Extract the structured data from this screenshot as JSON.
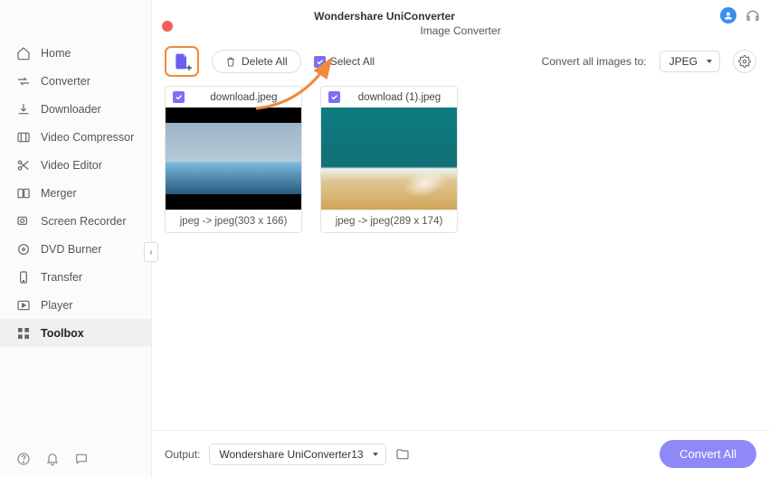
{
  "app_title": "Wondershare UniConverter",
  "panel_title": "Image Converter",
  "sidebar": {
    "items": [
      {
        "label": "Home"
      },
      {
        "label": "Converter"
      },
      {
        "label": "Downloader"
      },
      {
        "label": "Video Compressor"
      },
      {
        "label": "Video Editor"
      },
      {
        "label": "Merger"
      },
      {
        "label": "Screen Recorder"
      },
      {
        "label": "DVD Burner"
      },
      {
        "label": "Transfer"
      },
      {
        "label": "Player"
      },
      {
        "label": "Toolbox"
      }
    ],
    "active_index": 10
  },
  "toolbar": {
    "delete_all_label": "Delete All",
    "select_all_label": "Select All",
    "convert_all_to_label": "Convert all images to:",
    "format_selected": "JPEG"
  },
  "images": [
    {
      "selected": true,
      "name": "download.jpeg",
      "conversion": "jpeg -> jpeg(303 x 166)",
      "thumb": "ocean"
    },
    {
      "selected": true,
      "name": "download (1).jpeg",
      "conversion": "jpeg -> jpeg(289 x 174)",
      "thumb": "beach"
    }
  ],
  "footer": {
    "output_label": "Output:",
    "output_path": "Wondershare UniConverter13",
    "convert_all_label": "Convert All"
  }
}
